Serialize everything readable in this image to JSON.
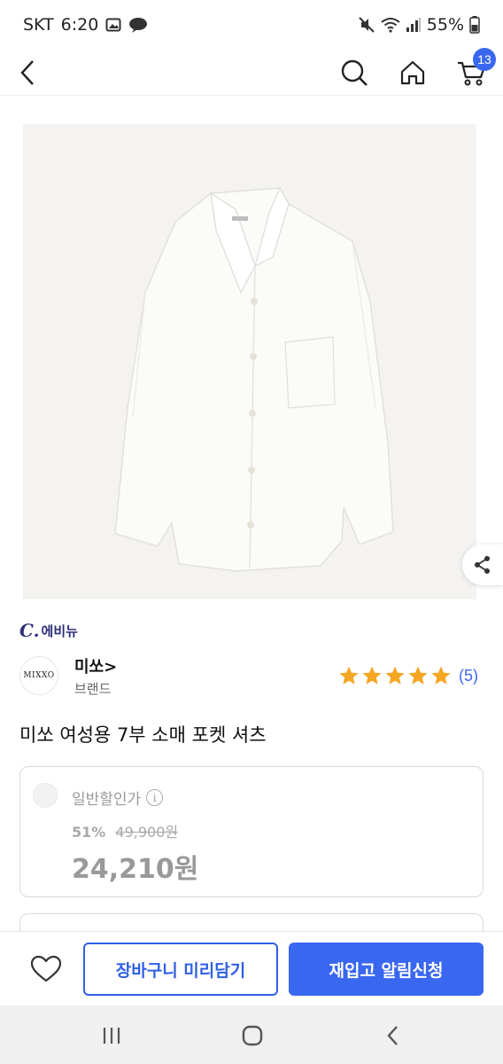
{
  "status_bar": {
    "carrier": "SKT",
    "time": "6:20",
    "battery": "55%"
  },
  "nav": {
    "back_icon": "back-arrow-icon",
    "search_icon": "search-icon",
    "home_icon": "home-icon",
    "cart_icon": "cart-icon",
    "cart_count": "13"
  },
  "seller": {
    "logo_letter": "C.",
    "logo_text": "에비뉴"
  },
  "brand": {
    "avatar_text": "MIXXO",
    "name": "미쏘>",
    "subtitle": "브랜드",
    "rating_stars": 5,
    "review_count": "(5)"
  },
  "product": {
    "title": "미쏘 여성용 7부 소매 포켓 셔츠"
  },
  "price": {
    "label": "일반할인가",
    "discount_rate": "51%",
    "original_price": "49,900원",
    "final_price": "24,210원"
  },
  "actions": {
    "wishlist_icon": "heart-icon",
    "cart_button": "장바구니 미리담기",
    "alert_button": "재입고 알림신청"
  },
  "colors": {
    "accent": "#3a67f0",
    "star": "#f5a623"
  }
}
